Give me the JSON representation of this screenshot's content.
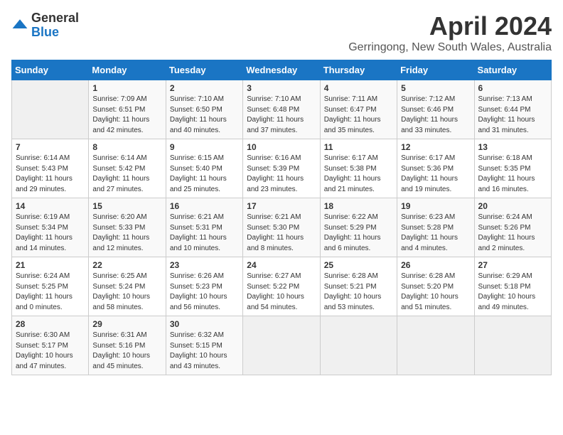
{
  "logo": {
    "general": "General",
    "blue": "Blue"
  },
  "title": "April 2024",
  "subtitle": "Gerringong, New South Wales, Australia",
  "headers": [
    "Sunday",
    "Monday",
    "Tuesday",
    "Wednesday",
    "Thursday",
    "Friday",
    "Saturday"
  ],
  "weeks": [
    [
      {
        "day": "",
        "info": ""
      },
      {
        "day": "1",
        "info": "Sunrise: 7:09 AM\nSunset: 6:51 PM\nDaylight: 11 hours\nand 42 minutes."
      },
      {
        "day": "2",
        "info": "Sunrise: 7:10 AM\nSunset: 6:50 PM\nDaylight: 11 hours\nand 40 minutes."
      },
      {
        "day": "3",
        "info": "Sunrise: 7:10 AM\nSunset: 6:48 PM\nDaylight: 11 hours\nand 37 minutes."
      },
      {
        "day": "4",
        "info": "Sunrise: 7:11 AM\nSunset: 6:47 PM\nDaylight: 11 hours\nand 35 minutes."
      },
      {
        "day": "5",
        "info": "Sunrise: 7:12 AM\nSunset: 6:46 PM\nDaylight: 11 hours\nand 33 minutes."
      },
      {
        "day": "6",
        "info": "Sunrise: 7:13 AM\nSunset: 6:44 PM\nDaylight: 11 hours\nand 31 minutes."
      }
    ],
    [
      {
        "day": "7",
        "info": "Sunrise: 6:14 AM\nSunset: 5:43 PM\nDaylight: 11 hours\nand 29 minutes."
      },
      {
        "day": "8",
        "info": "Sunrise: 6:14 AM\nSunset: 5:42 PM\nDaylight: 11 hours\nand 27 minutes."
      },
      {
        "day": "9",
        "info": "Sunrise: 6:15 AM\nSunset: 5:40 PM\nDaylight: 11 hours\nand 25 minutes."
      },
      {
        "day": "10",
        "info": "Sunrise: 6:16 AM\nSunset: 5:39 PM\nDaylight: 11 hours\nand 23 minutes."
      },
      {
        "day": "11",
        "info": "Sunrise: 6:17 AM\nSunset: 5:38 PM\nDaylight: 11 hours\nand 21 minutes."
      },
      {
        "day": "12",
        "info": "Sunrise: 6:17 AM\nSunset: 5:36 PM\nDaylight: 11 hours\nand 19 minutes."
      },
      {
        "day": "13",
        "info": "Sunrise: 6:18 AM\nSunset: 5:35 PM\nDaylight: 11 hours\nand 16 minutes."
      }
    ],
    [
      {
        "day": "14",
        "info": "Sunrise: 6:19 AM\nSunset: 5:34 PM\nDaylight: 11 hours\nand 14 minutes."
      },
      {
        "day": "15",
        "info": "Sunrise: 6:20 AM\nSunset: 5:33 PM\nDaylight: 11 hours\nand 12 minutes."
      },
      {
        "day": "16",
        "info": "Sunrise: 6:21 AM\nSunset: 5:31 PM\nDaylight: 11 hours\nand 10 minutes."
      },
      {
        "day": "17",
        "info": "Sunrise: 6:21 AM\nSunset: 5:30 PM\nDaylight: 11 hours\nand 8 minutes."
      },
      {
        "day": "18",
        "info": "Sunrise: 6:22 AM\nSunset: 5:29 PM\nDaylight: 11 hours\nand 6 minutes."
      },
      {
        "day": "19",
        "info": "Sunrise: 6:23 AM\nSunset: 5:28 PM\nDaylight: 11 hours\nand 4 minutes."
      },
      {
        "day": "20",
        "info": "Sunrise: 6:24 AM\nSunset: 5:26 PM\nDaylight: 11 hours\nand 2 minutes."
      }
    ],
    [
      {
        "day": "21",
        "info": "Sunrise: 6:24 AM\nSunset: 5:25 PM\nDaylight: 11 hours\nand 0 minutes."
      },
      {
        "day": "22",
        "info": "Sunrise: 6:25 AM\nSunset: 5:24 PM\nDaylight: 10 hours\nand 58 minutes."
      },
      {
        "day": "23",
        "info": "Sunrise: 6:26 AM\nSunset: 5:23 PM\nDaylight: 10 hours\nand 56 minutes."
      },
      {
        "day": "24",
        "info": "Sunrise: 6:27 AM\nSunset: 5:22 PM\nDaylight: 10 hours\nand 54 minutes."
      },
      {
        "day": "25",
        "info": "Sunrise: 6:28 AM\nSunset: 5:21 PM\nDaylight: 10 hours\nand 53 minutes."
      },
      {
        "day": "26",
        "info": "Sunrise: 6:28 AM\nSunset: 5:20 PM\nDaylight: 10 hours\nand 51 minutes."
      },
      {
        "day": "27",
        "info": "Sunrise: 6:29 AM\nSunset: 5:18 PM\nDaylight: 10 hours\nand 49 minutes."
      }
    ],
    [
      {
        "day": "28",
        "info": "Sunrise: 6:30 AM\nSunset: 5:17 PM\nDaylight: 10 hours\nand 47 minutes."
      },
      {
        "day": "29",
        "info": "Sunrise: 6:31 AM\nSunset: 5:16 PM\nDaylight: 10 hours\nand 45 minutes."
      },
      {
        "day": "30",
        "info": "Sunrise: 6:32 AM\nSunset: 5:15 PM\nDaylight: 10 hours\nand 43 minutes."
      },
      {
        "day": "",
        "info": ""
      },
      {
        "day": "",
        "info": ""
      },
      {
        "day": "",
        "info": ""
      },
      {
        "day": "",
        "info": ""
      }
    ]
  ]
}
